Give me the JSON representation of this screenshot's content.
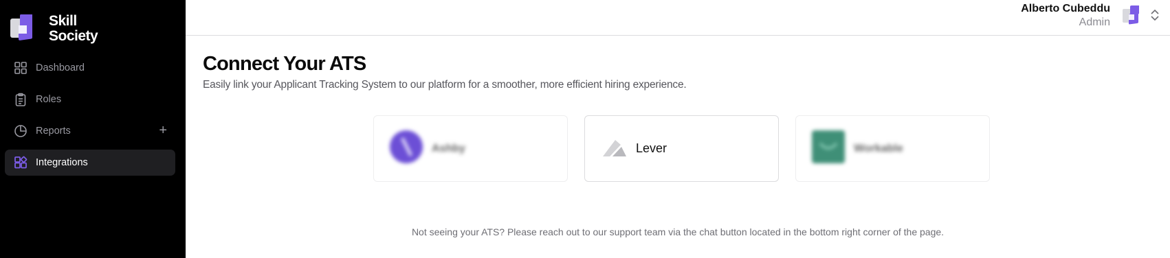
{
  "brand": {
    "line1": "Skill",
    "line2": "Society",
    "accent": "#7c5ce6"
  },
  "sidebar": {
    "items": [
      {
        "label": "Dashboard",
        "icon": "grid-icon"
      },
      {
        "label": "Roles",
        "icon": "clipboard-icon"
      },
      {
        "label": "Reports",
        "icon": "pie-chart-icon",
        "action": "+"
      },
      {
        "label": "Integrations",
        "icon": "integrations-icon",
        "active": true
      }
    ]
  },
  "header": {
    "user_name": "Alberto Cubeddu",
    "user_role": "Admin",
    "switcher_icon": "chevron-up-down-icon"
  },
  "main": {
    "title": "Connect Your ATS",
    "subtitle": "Easily link your Applicant Tracking System to our platform for a smoother, more efficient hiring experience.",
    "integrations": [
      {
        "label": "Ashby",
        "icon": "ashby-logo",
        "color": "#6c4fd6",
        "blurred": true
      },
      {
        "label": "Lever",
        "icon": "lever-logo",
        "color": "#b9b9bd",
        "blurred": false
      },
      {
        "label": "Workable",
        "icon": "workable-logo",
        "color": "#3f8f77",
        "blurred": true
      }
    ],
    "footer_note": "Not seeing your ATS? Please reach out to our support team via the chat button located in the bottom right corner of the page."
  }
}
